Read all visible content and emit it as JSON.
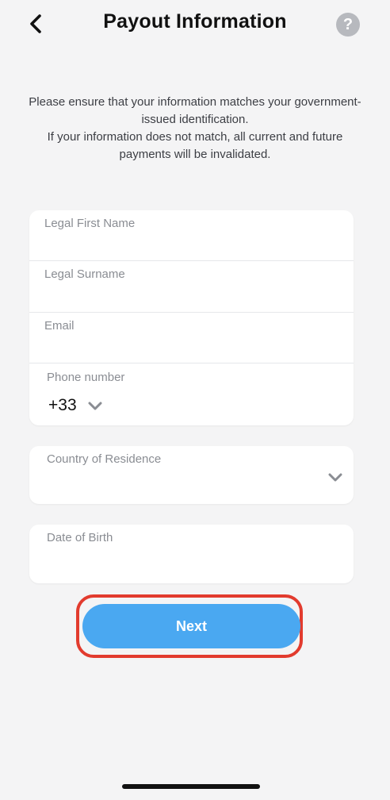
{
  "header": {
    "title": "Payout Information",
    "help_glyph": "?"
  },
  "intro": {
    "line1": "Please ensure that your information matches your government-issued identification.",
    "line2": "If your information does not match, all current and future payments will be invalidated."
  },
  "form": {
    "first_name_label": "Legal First Name",
    "surname_label": "Legal Surname",
    "email_label": "Email",
    "phone_label": "Phone number",
    "phone_code": "+33",
    "country_label": "Country of Residence",
    "dob_label": "Date of Birth"
  },
  "actions": {
    "next_label": "Next"
  },
  "colors": {
    "accent": "#4aa8f1",
    "highlight": "#e23b2e",
    "background": "#f4f4f5"
  }
}
